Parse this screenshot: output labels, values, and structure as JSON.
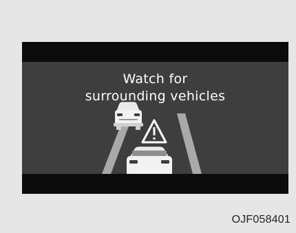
{
  "display": {
    "message_line1": "Watch for",
    "message_line2": "surrounding vehicles"
  },
  "icons": {
    "warning": "warning-triangle-icon",
    "side_vehicle": "car-rear-icon",
    "own_vehicle": "car-rear-icon"
  },
  "colors": {
    "background": "#e6e6e6",
    "screen_frame": "#0b0b0b",
    "screen_area": "#3e3e3e",
    "text": "#ffffff"
  },
  "figure": {
    "code": "OJF058401"
  }
}
